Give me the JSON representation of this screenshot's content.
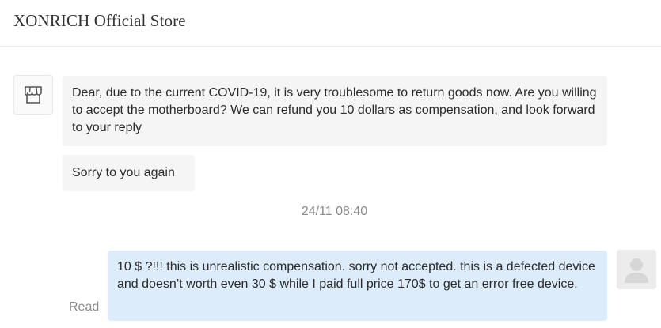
{
  "header": {
    "title": "XONRICH Official Store"
  },
  "icons": {
    "store_avatar": "store-icon",
    "user_avatar": "user-silhouette-icon"
  },
  "colors": {
    "incoming_bubble": "#f5f5f5",
    "outgoing_bubble": "#dcecfb",
    "muted_text": "#8a8a8a"
  },
  "messages": [
    {
      "from": "store",
      "text": "Dear, due to the current COVID-19, it is very troublesome to return goods now. Are you willing to accept the motherboard? We can refund you 10 dollars as compensation, and look forward to your reply"
    },
    {
      "from": "store",
      "text": "Sorry to you again"
    },
    {
      "from": "user",
      "text": "10 $ ?!!! this is unrealistic compensation. sorry not accepted. this is a defected device and doesn’t worth even 30 $ while I paid full price 170$ to get an error free device."
    }
  ],
  "timestamp": "24/11 08:40",
  "read_status": "Read"
}
